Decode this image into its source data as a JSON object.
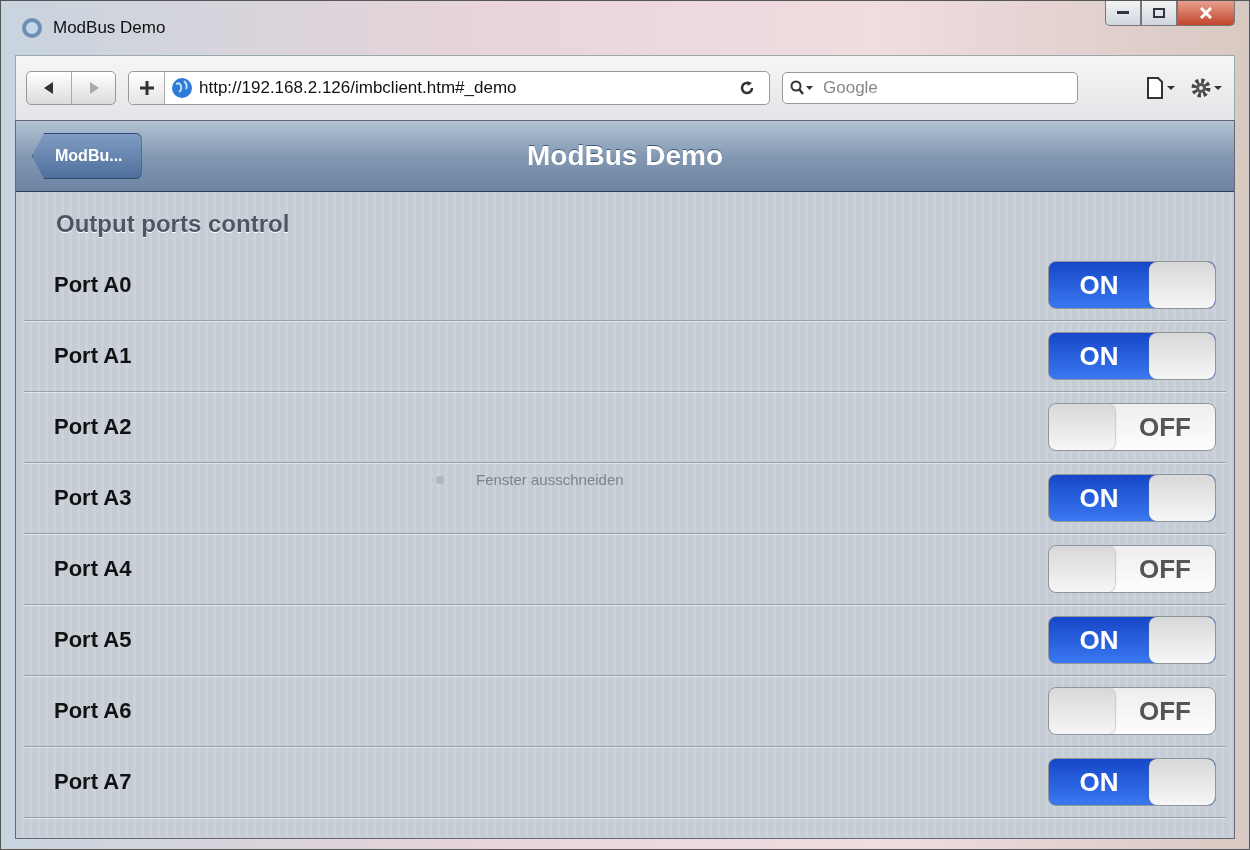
{
  "window": {
    "title": "ModBus Demo"
  },
  "browser": {
    "url": "http://192.168.2.126/imbclient.htm#_demo",
    "search_placeholder": "Google"
  },
  "header": {
    "back_button": "ModBu...",
    "title": "ModBus Demo"
  },
  "section_title": "Output ports control",
  "ports": [
    {
      "label": "Port A0",
      "on": true,
      "state_text": "ON"
    },
    {
      "label": "Port A1",
      "on": true,
      "state_text": "ON"
    },
    {
      "label": "Port A2",
      "on": false,
      "state_text": "OFF"
    },
    {
      "label": "Port A3",
      "on": true,
      "state_text": "ON"
    },
    {
      "label": "Port A4",
      "on": false,
      "state_text": "OFF"
    },
    {
      "label": "Port A5",
      "on": true,
      "state_text": "ON"
    },
    {
      "label": "Port A6",
      "on": false,
      "state_text": "OFF"
    },
    {
      "label": "Port A7",
      "on": true,
      "state_text": "ON"
    }
  ],
  "ghost_menu_item": "Fenster ausschneiden"
}
